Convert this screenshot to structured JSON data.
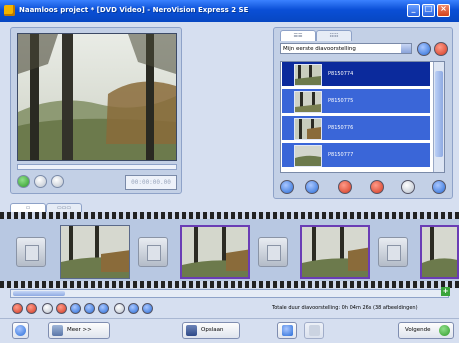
{
  "window": {
    "title": "Naamloos project * [DVD Video] - NeroVision Express 2 SE",
    "minimize": "_",
    "maximize": "□",
    "close": "×"
  },
  "preview": {
    "timecode": "00:00:00.00"
  },
  "right_panel": {
    "tabs": [
      "☰☰",
      "☷☷"
    ],
    "slideshow_select": "Mijn eerste diavoorstelling",
    "items": [
      {
        "label": "P8150774",
        "selected": true
      },
      {
        "label": "P8150775",
        "selected": false
      },
      {
        "label": "P8150776",
        "selected": false
      },
      {
        "label": "P8150777",
        "selected": false
      }
    ]
  },
  "storyboard": {
    "tabs": [
      "▭",
      "▭▭▭"
    ],
    "total_label": "Totale duur diavoorstelling: 0h 04m 26s (38 afbeeldingen)"
  },
  "buttons": {
    "help": "?",
    "more": "Meer >>",
    "save": "Opslaan",
    "next": "Volgende"
  },
  "colors": {
    "titlebar": "#0a4fd6",
    "list_item": "#3a66d8",
    "list_selected": "#0b2a9c",
    "accent_red": "#d23a22",
    "accent_blue": "#2a6ed8",
    "accent_green": "#3aa43a"
  }
}
